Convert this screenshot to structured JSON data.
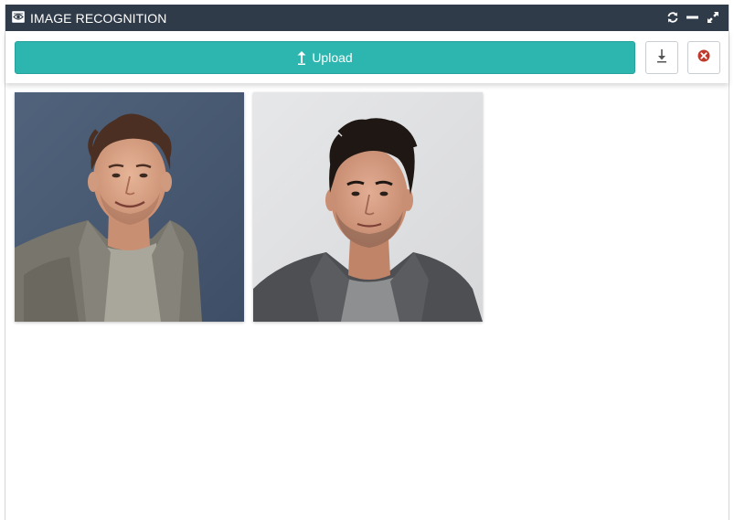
{
  "window": {
    "title": "IMAGE RECOGNITION",
    "icons": [
      "eye-icon",
      "refresh-icon",
      "minimize-icon",
      "expand-icon"
    ]
  },
  "toolbar": {
    "upload_label": "Upload",
    "upload_color": "#2db6b0",
    "icons": [
      "upload-arrow-icon",
      "download-icon",
      "close-circle-icon"
    ],
    "close_color": "#c0392b"
  },
  "gallery": {
    "images": [
      {
        "subject": "man-gray-jacket-blue-background"
      },
      {
        "subject": "man-dark-jacket-light-background"
      }
    ]
  },
  "colors": {
    "titlebar": "#2f3b49"
  }
}
